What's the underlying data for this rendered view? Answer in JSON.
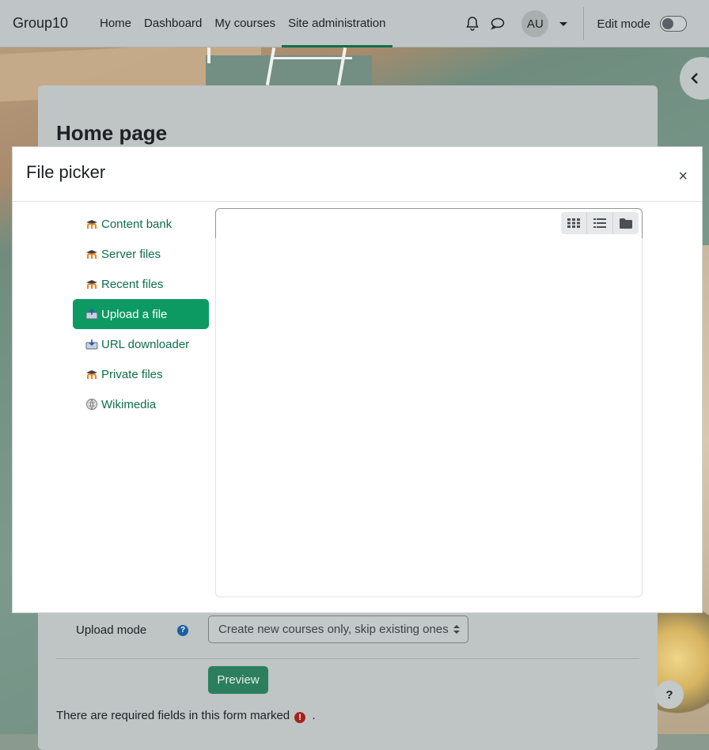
{
  "navbar": {
    "brand": "Group10",
    "items": [
      {
        "label": "Home"
      },
      {
        "label": "Dashboard"
      },
      {
        "label": "My courses"
      },
      {
        "label": "Site administration",
        "active": true
      }
    ],
    "avatar_initials": "AU",
    "edit_mode_label": "Edit mode",
    "edit_mode_on": false
  },
  "page": {
    "title": "Home page"
  },
  "modal": {
    "title": "File picker",
    "close_label": "×",
    "repositories": [
      {
        "label": "Content bank",
        "icon": "moodle-icon"
      },
      {
        "label": "Server files",
        "icon": "moodle-icon"
      },
      {
        "label": "Recent files",
        "icon": "moodle-icon"
      },
      {
        "label": "Upload a file",
        "icon": "upload-icon",
        "active": true
      },
      {
        "label": "URL downloader",
        "icon": "url-download-icon"
      },
      {
        "label": "Private files",
        "icon": "moodle-icon"
      },
      {
        "label": "Wikimedia",
        "icon": "wikimedia-icon"
      }
    ],
    "view_buttons": [
      "grid-view-icon",
      "list-view-icon",
      "folder-view-icon"
    ]
  },
  "form": {
    "upload_mode_label": "Upload mode",
    "upload_mode_value": "Create new courses only, skip existing ones",
    "preview_label": "Preview",
    "required_note": "There are required fields in this form marked",
    "required_note_end": ".",
    "help_fab": "?"
  },
  "colors": {
    "accent": "#0f6e4a",
    "active_repo": "#0d9a62"
  }
}
